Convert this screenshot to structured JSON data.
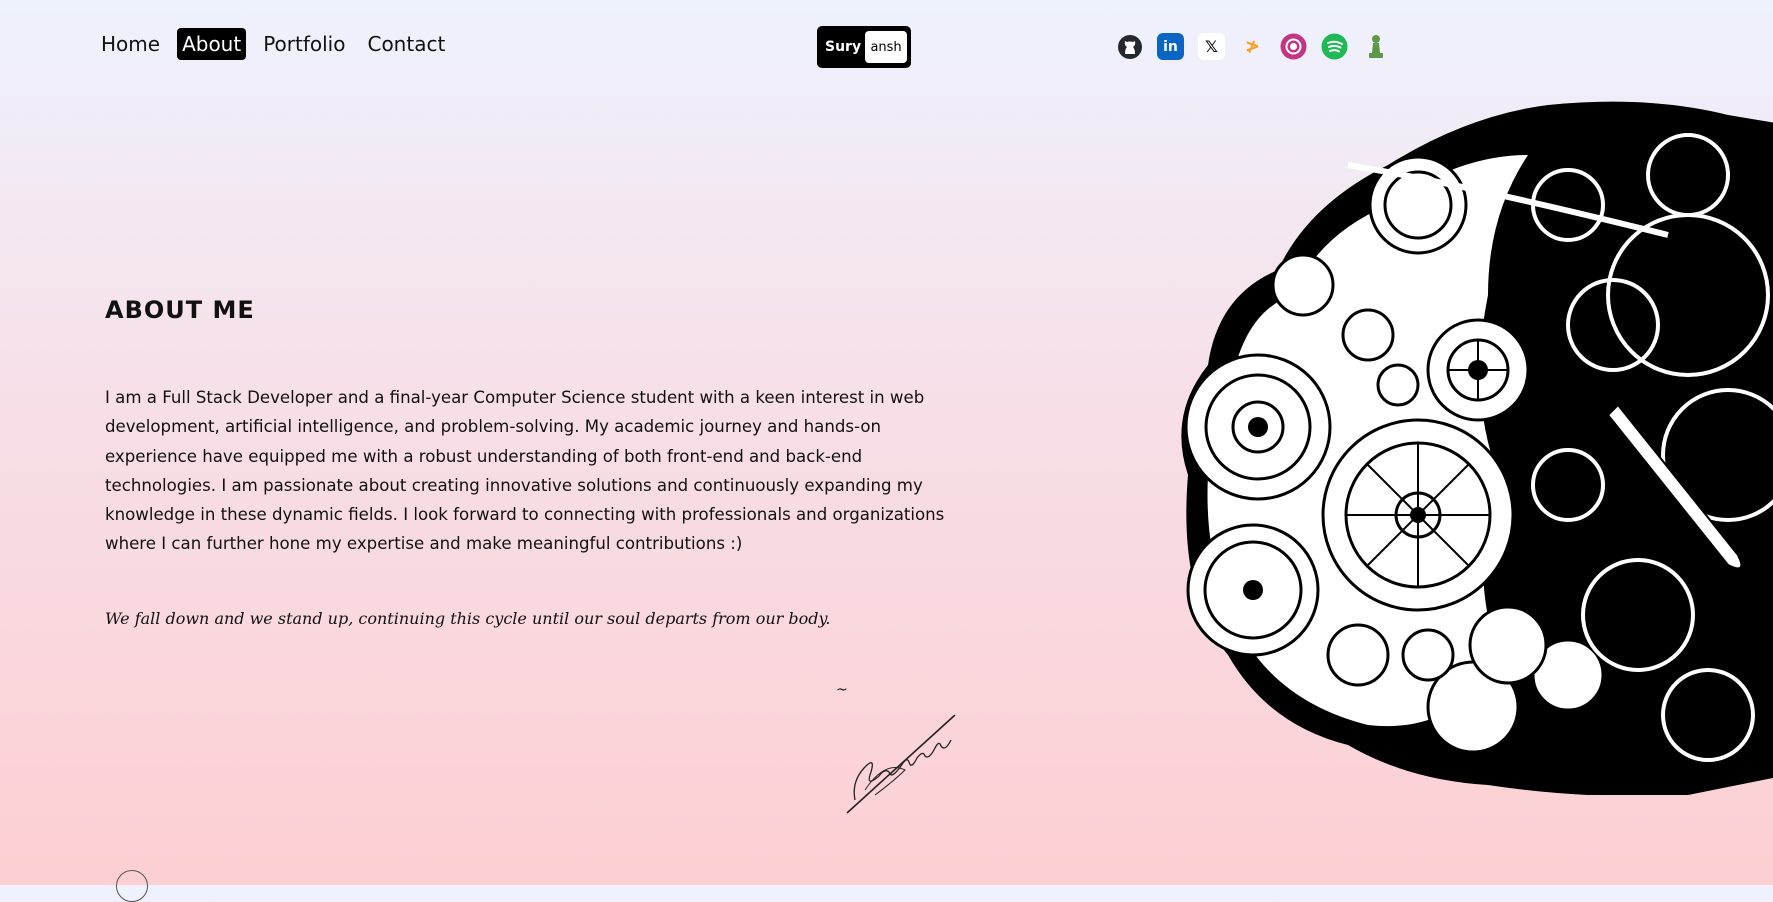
{
  "nav": [
    {
      "label": "Home",
      "active": false
    },
    {
      "label": "About",
      "active": true
    },
    {
      "label": "Portfolio",
      "active": false
    },
    {
      "label": "Contact",
      "active": false
    }
  ],
  "logo": {
    "left": "Sury",
    "right": "ansh"
  },
  "social": [
    {
      "icon": "github-icon",
      "color": "#24292e"
    },
    {
      "icon": "linkedin-icon",
      "color": "#0a66c2"
    },
    {
      "icon": "x-icon",
      "color": "#000000"
    },
    {
      "icon": "leetcode-icon",
      "color": "#f89f1b"
    },
    {
      "icon": "instagram-icon",
      "color": "#c13584"
    },
    {
      "icon": "spotify-icon",
      "color": "#1db954"
    },
    {
      "icon": "chess-icon",
      "color": "#5d9948"
    }
  ],
  "about": {
    "heading": "ABOUT ME",
    "bio": "I am a Full Stack Developer and a final-year Computer Science student with a keen interest in web development, artificial intelligence, and problem-solving. My academic journey and hands-on experience have equipped me with a robust understanding of both front-end and back-end technologies. I am passionate about creating innovative solutions and continuously expanding my knowledge in these dynamic fields. I look forward to connecting with professionals and organizations where I can further hone my expertise and make meaningful contributions :)",
    "quote": "We fall down and we stand up, continuing this cycle until our soul departs from our body.",
    "tilde": "~"
  }
}
